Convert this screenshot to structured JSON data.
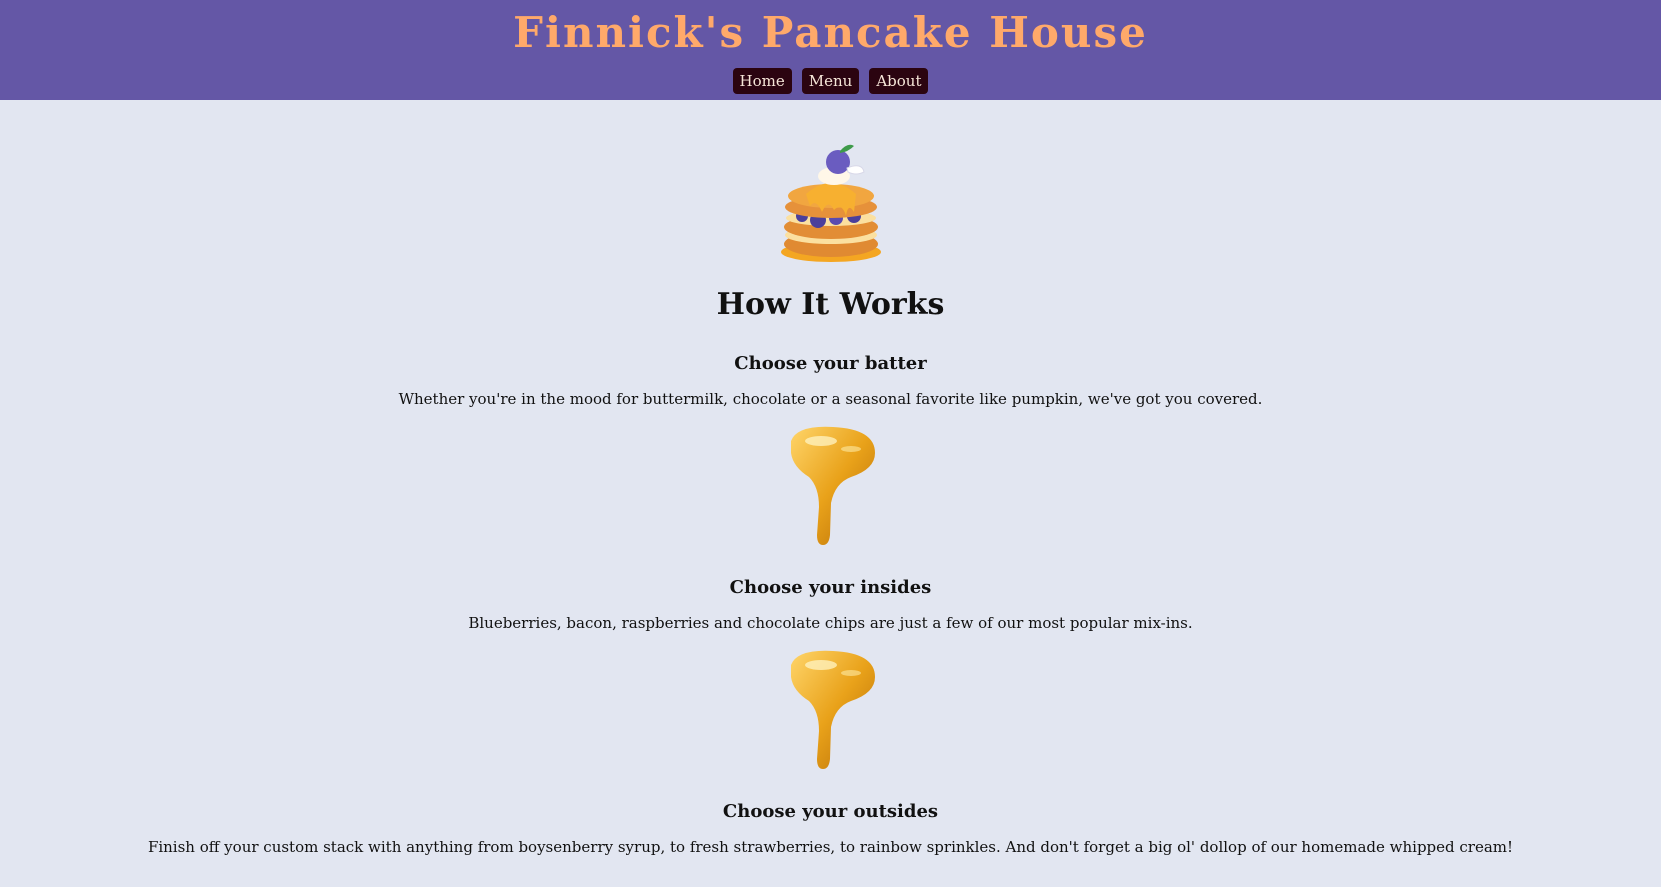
{
  "header": {
    "title": "Finnick's Pancake House",
    "nav": [
      {
        "label": "Home"
      },
      {
        "label": "Menu"
      },
      {
        "label": "About"
      }
    ]
  },
  "main": {
    "mascot_icon": "pancake-stack-mascot-icon",
    "heading": "How It Works",
    "steps": [
      {
        "title": "Choose your batter",
        "text": "Whether you're in the mood for buttermilk, chocolate or a seasonal favorite like pumpkin, we've got you covered."
      },
      {
        "title": "Choose your insides",
        "text": "Blueberries, bacon, raspberries and chocolate chips are just a few of our most popular mix-ins."
      },
      {
        "title": "Choose your outsides",
        "text": "Finish off your custom stack with anything from boysenberry syrup, to fresh strawberries, to rainbow sprinkles. And don't forget a big ol' dollop of our homemade whipped cream!"
      }
    ],
    "divider_icon": "syrup-drip-icon"
  },
  "colors": {
    "header_bg": "#6457a6",
    "title": "#ffa96a",
    "nav_bg": "#2b0410",
    "page_bg": "#e2e6f1"
  }
}
